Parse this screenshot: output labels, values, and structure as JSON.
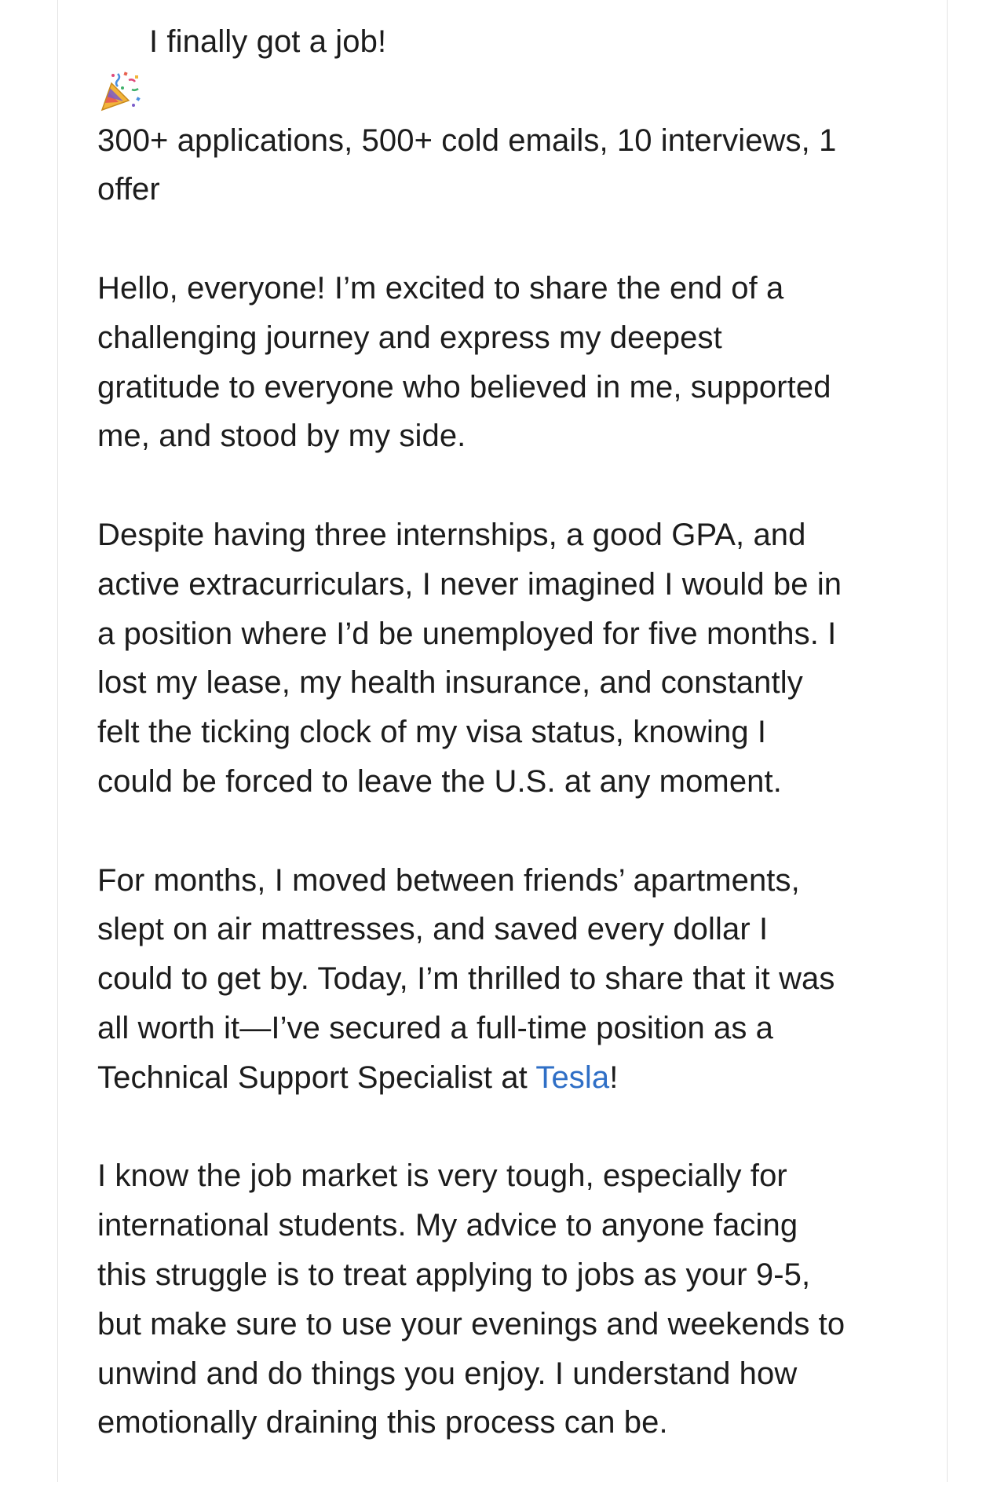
{
  "post": {
    "icon": "party-popper-icon",
    "title": "I finally got a job!",
    "stats": "300+ applications, 500+ cold emails, 10 interviews, 1\noffer",
    "paragraph_intro": "Hello, everyone! I’m excited to share the end of a\nchallenging journey and express my deepest\ngratitude to everyone who believed in me, supported\nme, and stood by my side.",
    "paragraph_struggle": "Despite having three internships, a good GPA, and\nactive extracurriculars, I never imagined I would be in\na position where I’d be unemployed for five months. I\nlost my lease, my health insurance, and constantly\nfelt the ticking clock of my visa status, knowing I\ncould be forced to leave the U.S. at any moment.",
    "paragraph_news_before": "For months, I moved between friends’ apartments,\nslept on air mattresses, and saved every dollar I\ncould to get by. Today, I’m thrilled to share that it was\nall worth it—I’ve secured a full-time position as a\nTechnical Support Specialist at ",
    "company_link": "Tesla",
    "paragraph_news_after": "!",
    "paragraph_advice": "I know the job market is very tough, especially for\ninternational students. My advice to anyone facing\nthis struggle is to treat applying to jobs as your 9-5,\nbut make sure to use your evenings and weekends to\nunwind and do things you enjoy. I understand how\nemotionally draining this process can be."
  },
  "colors": {
    "text": "#1c1c1c",
    "link": "#2f6fc6",
    "border": "#e3e3e3",
    "background": "#ffffff"
  }
}
